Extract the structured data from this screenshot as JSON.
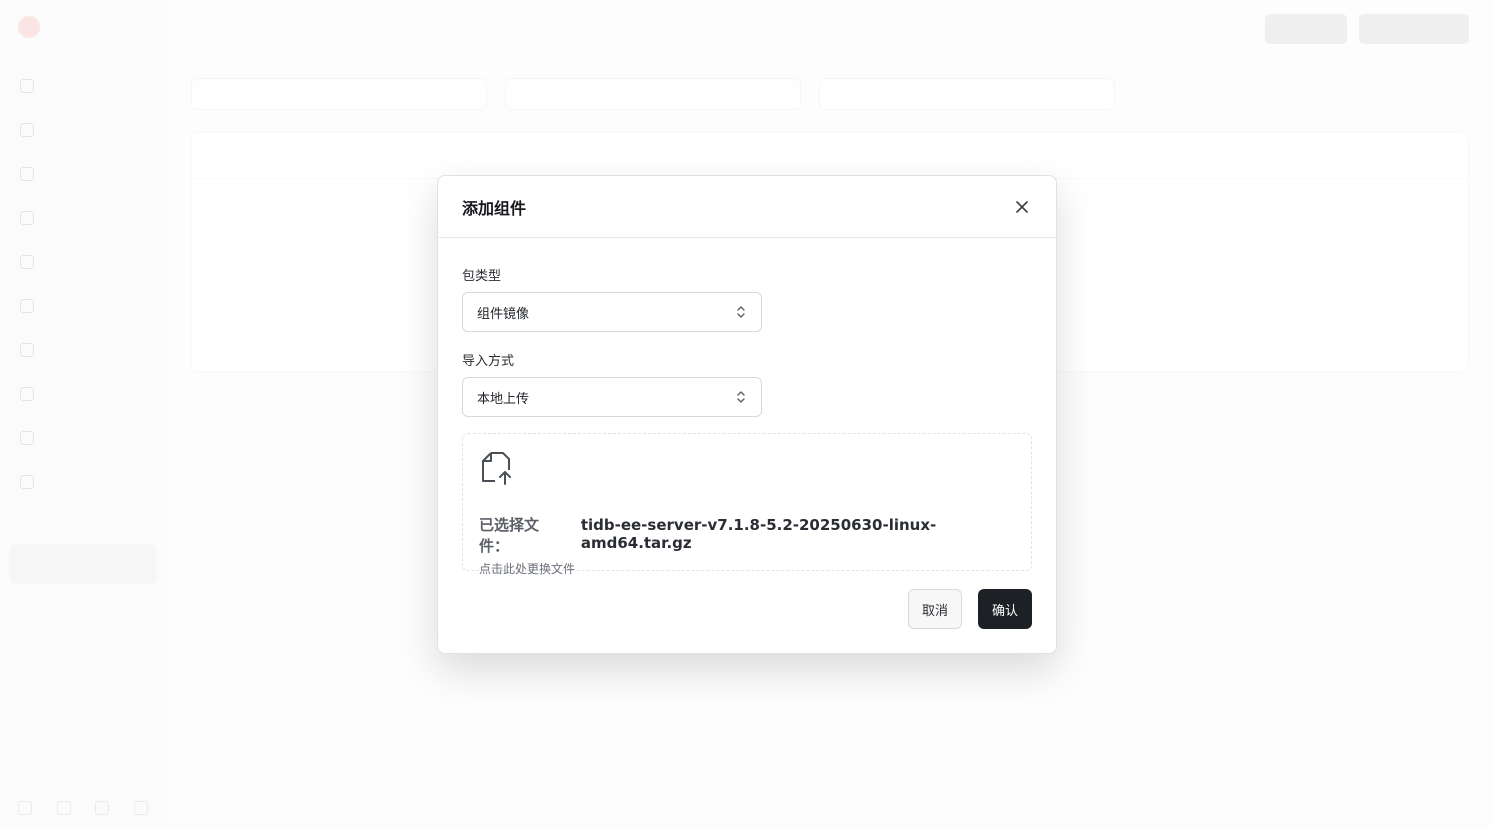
{
  "modal": {
    "title": "添加组件",
    "package_type_label": "包类型",
    "package_type_value": "组件镜像",
    "import_method_label": "导入方式",
    "import_method_value": "本地上传",
    "upload": {
      "selected_prefix": "已选择文件：",
      "file_name": "tidb-ee-server-v7.1.8-5.2-20250630-linux-amd64.tar.gz",
      "hint": "点击此处更换文件"
    },
    "cancel_label": "取消",
    "confirm_label": "确认"
  },
  "icons": [
    "close-icon",
    "chevron-updown-icon",
    "file-upload-icon"
  ]
}
